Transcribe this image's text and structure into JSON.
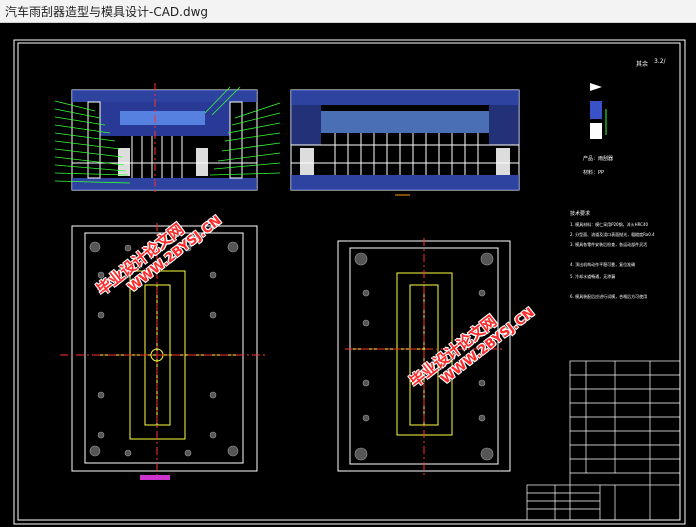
{
  "window": {
    "title": "汽车雨刮器造型与模具设计-CAD.dwg"
  },
  "drawing": {
    "roughness_symbol": "3.2/",
    "roughness_note": "其余",
    "part_label": "产品：雨刮器",
    "material_label": "材料：PP",
    "tech_requirements": [
      "技术要求",
      "1. 模具材料：模仁采用P20钢，淬火HRC40",
      "2. 分型面、流道及浇口表面抛光，粗糙度Ra0.4",
      "3. 模具各零件安装后检查，各运动部件灵活",
      "4. 顶出机构动作平稳可靠，复位准确",
      "5. 冷却水道畅通，无渗漏",
      "6. 模具装配后应进行试模，合格后方可使用"
    ],
    "title_block_rows": [
      "",
      "",
      "",
      "",
      "",
      "",
      ""
    ]
  },
  "watermarks": [
    {
      "line1": "毕业设计论文网",
      "line2": "WWW.2BYSJ.CN"
    },
    {
      "line1": "毕业设计论文网",
      "line2": "WWW.2BYSJ.CN"
    }
  ],
  "colors": {
    "drawing_line": "#ffffff",
    "center_line": "#ff3030",
    "part_outline": "#ffff40",
    "hatch": "#3a52c8",
    "leader": "#33ff33",
    "watermark": "#ff2a2a"
  }
}
